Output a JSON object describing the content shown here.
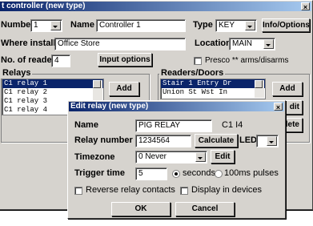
{
  "controller_window": {
    "title": "t controller (new type)",
    "number_label": "Number",
    "number_value": "1",
    "name_label": "Name",
    "name_value": "Controller 1",
    "type_label": "Type",
    "type_value": "KEY",
    "info_options_button": "Info/Options",
    "where_installed_label": "Where installed",
    "where_installed_value": "Office Store",
    "location_label": "Location",
    "location_value": "MAIN",
    "num_readers_label": "No. of readers",
    "num_readers_value": "4",
    "input_options_button": "Input options",
    "presco_label": "Presco ** arms/disarms",
    "relays_group_label": "Relays",
    "relays": [
      "C1 relay 1",
      "C1 relay 2",
      "C1 relay 3",
      "C1 relay 4"
    ],
    "relays_add_button": "Add",
    "readers_group_label": "Readers/Doors",
    "readers": [
      "Stair 1 Entry Dr",
      "Union St Wst In"
    ],
    "readers_add_button": "Add",
    "readers_edit_button_partial": "dit",
    "readers_delete_button_partial": "lete"
  },
  "relay_dialog": {
    "title": "Edit relay (new type)",
    "name_label": "Name",
    "name_value": "PIG RELAY",
    "name_suffix": "C1 I4",
    "relay_number_label": "Relay number",
    "relay_number_value": "1234564",
    "calculate_button": "Calculate",
    "led_label": "LED",
    "led_value": "",
    "timezone_label": "Timezone",
    "timezone_value": "0 Never",
    "edit_button": "Edit",
    "trigger_time_label": "Trigger time",
    "trigger_time_value": "5",
    "seconds_label": "seconds",
    "pulses_label": "100ms pulses",
    "reverse_label": "Reverse relay contacts",
    "display_devices_label": "Display in devices",
    "ok_button": "OK",
    "cancel_button": "Cancel"
  }
}
